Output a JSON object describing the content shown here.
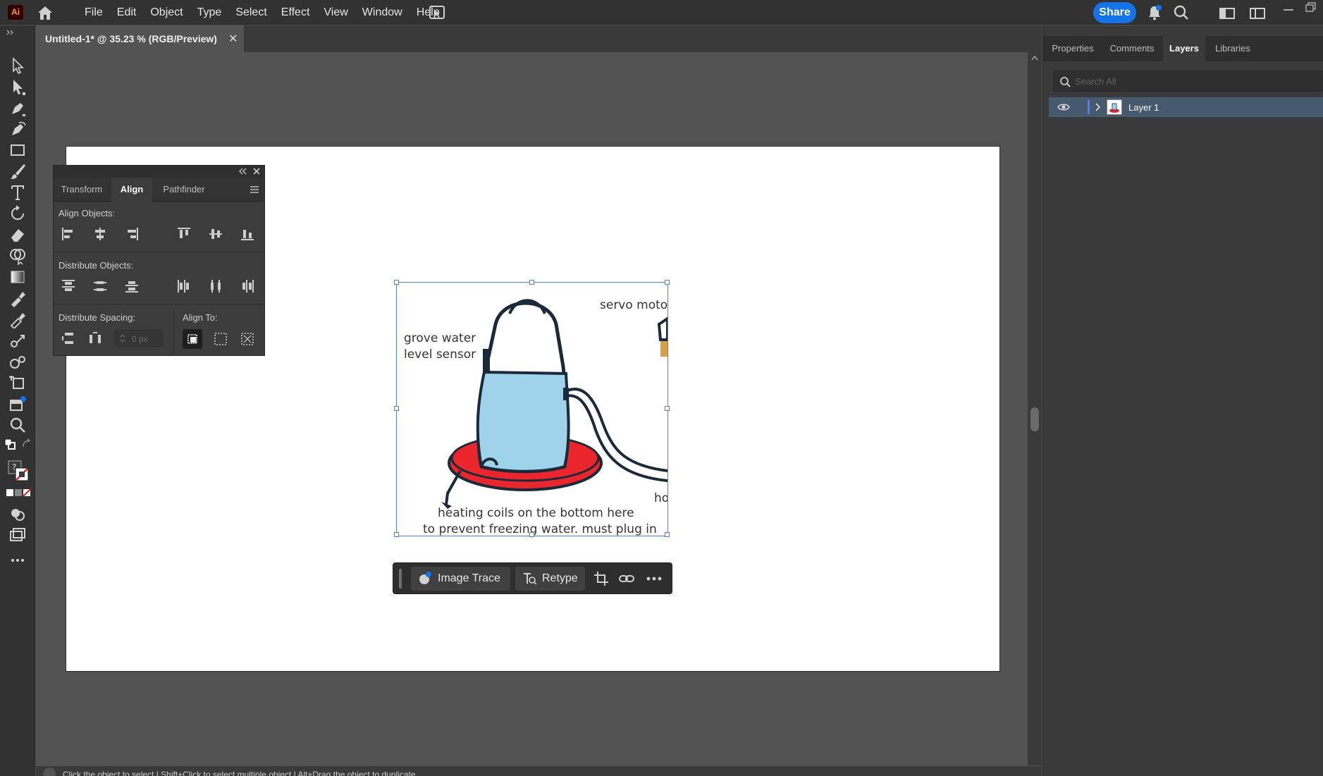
{
  "app": {
    "logo": "Ai",
    "menu": [
      "File",
      "Edit",
      "Object",
      "Type",
      "Select",
      "Effect",
      "View",
      "Window",
      "Help"
    ],
    "share_label": "Share"
  },
  "document": {
    "tab_title": "Untitled-1* @ 35.23 % (RGB/Preview)",
    "tab_close": "✕"
  },
  "placed_image": {
    "annotations": {
      "servo": "servo motor",
      "sensor_line1": "grove water",
      "sensor_line2": "level sensor",
      "heating_line1": "heating coils on the bottom here",
      "heating_line2": "to prevent freezing water. must plug in",
      "cut_text": "ho"
    }
  },
  "task_bar": {
    "image_trace_label": "Image Trace",
    "retype_label": "Retype"
  },
  "align_panel": {
    "tabs": [
      "Transform",
      "Align",
      "Pathfinder"
    ],
    "active_tab": "Align",
    "align_objects_label": "Align Objects:",
    "distribute_objects_label": "Distribute Objects:",
    "distribute_spacing_label": "Distribute Spacing:",
    "align_to_label": "Align To:",
    "spacing_value": "0 px"
  },
  "right_panel": {
    "tabs": [
      "Properties",
      "Comments",
      "Layers",
      "Libraries"
    ],
    "active_tab": "Layers",
    "search_placeholder": "Search All",
    "layers": [
      {
        "name": "Layer 1",
        "visible": true
      }
    ]
  },
  "status_bar": {
    "help_text": "Click the object to select  |  Shift+Click to select multiple object  |  Alt+Drag the object to duplicate"
  },
  "colors": {
    "accent": "#1473e6",
    "layer_color": "#4f7fff",
    "selection": "#4a7fd4",
    "water": "#9fd3ec",
    "heater": "#e8262b"
  }
}
